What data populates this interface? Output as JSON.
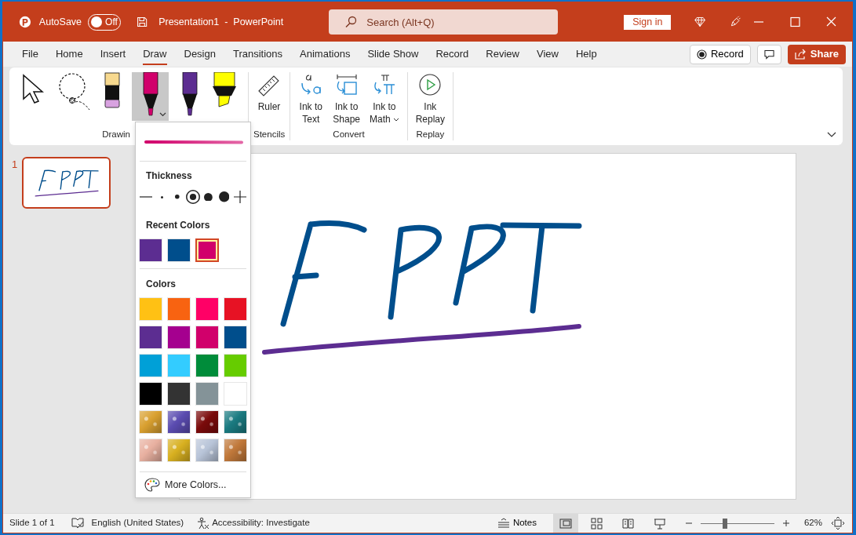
{
  "title_bar": {
    "autosave_label": "AutoSave",
    "autosave_on": false,
    "toggle_text": "Off",
    "title": "Presentation1  -  PowerPoint",
    "search_placeholder": "Search (Alt+Q)",
    "sign_in": "Sign in"
  },
  "tabs": [
    {
      "label": "File",
      "selected": false
    },
    {
      "label": "Home",
      "selected": false
    },
    {
      "label": "Insert",
      "selected": false
    },
    {
      "label": "Draw",
      "selected": true
    },
    {
      "label": "Design",
      "selected": false
    },
    {
      "label": "Transitions",
      "selected": false
    },
    {
      "label": "Animations",
      "selected": false
    },
    {
      "label": "Slide Show",
      "selected": false
    },
    {
      "label": "Record",
      "selected": false
    },
    {
      "label": "Review",
      "selected": false
    },
    {
      "label": "View",
      "selected": false
    },
    {
      "label": "Help",
      "selected": false
    }
  ],
  "tab_actions": {
    "record": "Record",
    "share": "Share"
  },
  "ribbon": {
    "drawing_tools": {
      "label": "Drawin",
      "tools": [
        {
          "kind": "select",
          "selected": false
        },
        {
          "kind": "lasso",
          "selected": false
        },
        {
          "kind": "eraser",
          "selected": false
        },
        {
          "kind": "pen",
          "color": "#d1006b",
          "selected": true
        },
        {
          "kind": "pen",
          "color": "#5c2d91",
          "selected": false
        },
        {
          "kind": "highlighter",
          "color": "#ffff00",
          "selected": false
        }
      ]
    },
    "groups": [
      {
        "label": "Stencils",
        "buttons": [
          {
            "kind": "ruler",
            "lines": [
              "Ruler"
            ]
          }
        ]
      },
      {
        "label": "Convert",
        "buttons": [
          {
            "kind": "ink-text",
            "lines": [
              "Ink to",
              "Text"
            ]
          },
          {
            "kind": "ink-shape",
            "lines": [
              "Ink to",
              "Shape"
            ]
          },
          {
            "kind": "ink-math",
            "lines": [
              "Ink to",
              "Math"
            ],
            "menu": true
          }
        ]
      },
      {
        "label": "Replay",
        "buttons": [
          {
            "kind": "replay",
            "lines": [
              "Ink",
              "Replay"
            ]
          }
        ]
      }
    ]
  },
  "pen_menu": {
    "thickness_label": "Thickness",
    "thickness": [
      {
        "kind": "minus"
      },
      {
        "kind": "size",
        "selected": false
      },
      {
        "kind": "size",
        "selected": false
      },
      {
        "kind": "size",
        "selected": true
      },
      {
        "kind": "size",
        "selected": false
      },
      {
        "kind": "size",
        "selected": false
      },
      {
        "kind": "plus"
      }
    ],
    "recent_label": "Recent Colors",
    "recent": [
      {
        "color": "#5c2d91",
        "selected": false
      },
      {
        "color": "#004e8c",
        "selected": false
      },
      {
        "color": "#d1006b",
        "selected": true
      }
    ],
    "colors_label": "Colors",
    "colors": [
      {
        "kind": "solid",
        "color": "#ffc114"
      },
      {
        "kind": "solid",
        "color": "#f86311"
      },
      {
        "kind": "solid",
        "color": "#ff0066"
      },
      {
        "kind": "solid",
        "color": "#e71224"
      },
      {
        "kind": "solid",
        "color": "#5c2d91"
      },
      {
        "kind": "solid",
        "color": "#a5008f"
      },
      {
        "kind": "solid",
        "color": "#d1006b"
      },
      {
        "kind": "solid",
        "color": "#004e8c"
      },
      {
        "kind": "solid",
        "color": "#00a0d7"
      },
      {
        "kind": "solid",
        "color": "#33ccff"
      },
      {
        "kind": "solid",
        "color": "#008c3a"
      },
      {
        "kind": "solid",
        "color": "#66cc00"
      },
      {
        "kind": "solid",
        "color": "#000000"
      },
      {
        "kind": "solid",
        "color": "#333333"
      },
      {
        "kind": "solid",
        "color": "#849398"
      },
      {
        "kind": "solid",
        "color": "#ffffff"
      },
      {
        "kind": "texture",
        "color": "#d9a030"
      },
      {
        "kind": "texture",
        "color": "#5a4bb0"
      },
      {
        "kind": "texture",
        "color": "#7a0a0a"
      },
      {
        "kind": "texture",
        "color": "#1a7a80"
      },
      {
        "kind": "texture",
        "color": "#e8b0a0"
      },
      {
        "kind": "texture",
        "color": "#d8b020"
      },
      {
        "kind": "texture",
        "color": "#b8c4d8"
      },
      {
        "kind": "texture",
        "color": "#c0783a"
      }
    ],
    "more_colors": "More Colors..."
  },
  "slides": [
    {
      "number": "1",
      "selected": true
    }
  ],
  "status_bar": {
    "slide": "Slide 1 of 1",
    "language": "English (United States)",
    "accessibility": "Accessibility: Investigate",
    "notes": "Notes",
    "views": [
      {
        "kind": "normal",
        "selected": true
      },
      {
        "kind": "sorter",
        "selected": false
      },
      {
        "kind": "reading",
        "selected": false
      },
      {
        "kind": "show",
        "selected": false
      }
    ],
    "zoom": {
      "level": 0.33,
      "reading": "62%"
    }
  }
}
